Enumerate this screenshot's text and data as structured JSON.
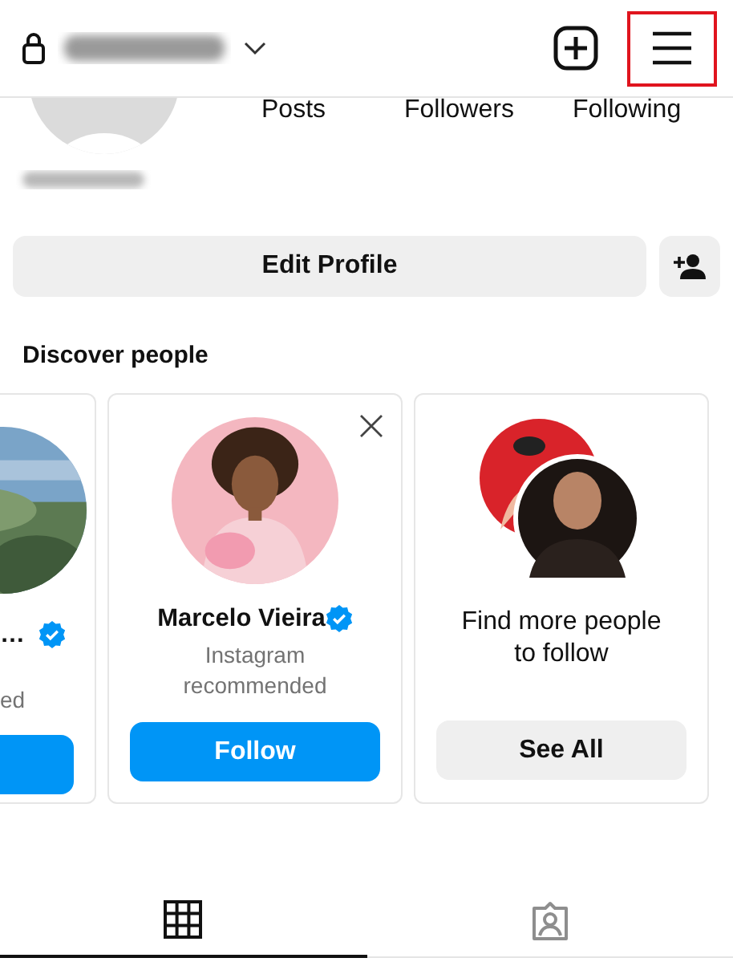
{
  "header": {
    "private": true
  },
  "stats": [
    {
      "label": "Posts"
    },
    {
      "label": "Followers"
    },
    {
      "label": "Following"
    }
  ],
  "edit_profile": "Edit Profile",
  "discover": {
    "title": "Discover people",
    "cards": [
      {
        "kind": "partial",
        "name": "…",
        "verified": true,
        "subtitle": "ed"
      },
      {
        "kind": "person",
        "name": "Marcelo Vieira",
        "verified": true,
        "subtitle": "Instagram recommended",
        "button": "Follow"
      },
      {
        "kind": "more",
        "name": "Find more people to follow",
        "button": "See All"
      }
    ]
  },
  "tabs": [
    {
      "kind": "grid",
      "selected": true
    },
    {
      "kind": "tagged",
      "selected": false
    }
  ]
}
